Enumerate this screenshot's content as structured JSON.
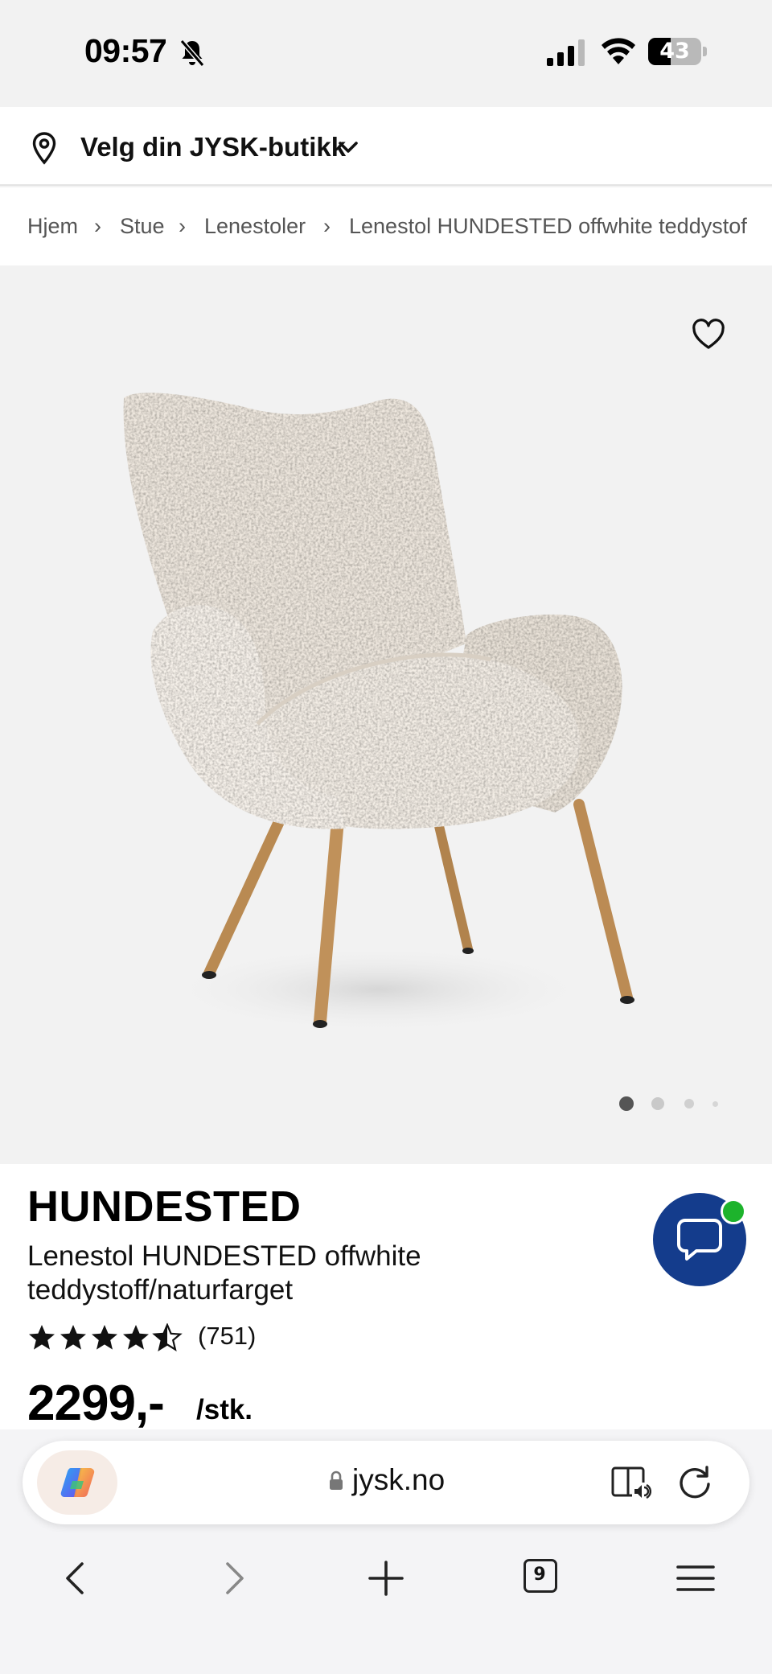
{
  "status_bar": {
    "time": "09:57",
    "battery_level": "43",
    "battery_fraction": 0.43
  },
  "store_selector": {
    "label": "Velg din JYSK-butikk"
  },
  "breadcrumb": {
    "items": [
      "Hjem",
      "Stue",
      "Lenestoler",
      "Lenestol HUNDESTED offwhite teddystoff/naturfarget"
    ],
    "separator": "›"
  },
  "gallery": {
    "image_count": 4,
    "active_index": 0
  },
  "product": {
    "name": "HUNDESTED",
    "description": "Lenestol HUNDESTED offwhite teddystoff/naturfarget",
    "rating": 4.5,
    "review_count": "(751)",
    "price": "2299,-",
    "unit": "/stk."
  },
  "browser": {
    "url": "jysk.no",
    "tab_count": "9"
  },
  "colors": {
    "chat_button": "#143c8c",
    "online_indicator": "#1db32c",
    "chair_fabric": "#f1ebe3",
    "chair_legs": "#b98a52"
  },
  "icons": [
    "bell-slash-icon",
    "signal-icon",
    "wifi-icon",
    "location-pin-icon",
    "chevron-down-icon",
    "heart-icon",
    "chat-icon",
    "copilot-icon",
    "lock-icon",
    "reader-audio-icon",
    "reload-icon",
    "back-icon",
    "forward-icon",
    "new-tab-icon",
    "tabs-icon",
    "menu-icon"
  ]
}
